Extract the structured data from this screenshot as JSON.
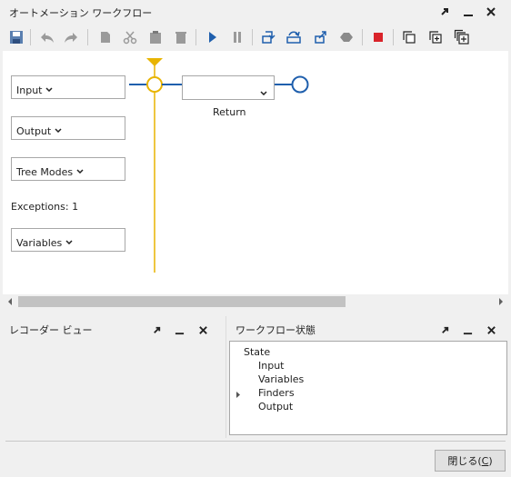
{
  "window": {
    "title": "オートメーション ワークフロー",
    "controls": [
      "float",
      "minimize",
      "close"
    ]
  },
  "toolbar": {
    "buttons": [
      "save-icon",
      "undo-icon",
      "redo-icon",
      "copy-icon",
      "cut-icon",
      "paste-icon",
      "delete-icon",
      "run-icon",
      "pause-icon",
      "step-into-icon",
      "step-over-icon",
      "step-out-icon",
      "breakpoint-icon",
      "stop-icon",
      "collapse-icon",
      "expand-icon",
      "expand-all-icon"
    ]
  },
  "canvas": {
    "input_label": "Input",
    "output_label": "Output",
    "tree_modes_label": "Tree Modes",
    "exceptions_label": "Exceptions: 1",
    "variables_label": "Variables",
    "return_label": "Return",
    "return_select_value": ""
  },
  "recorder_panel": {
    "title": "レコーダー ビュー"
  },
  "state_panel": {
    "title": "ワークフロー状態",
    "root": "State",
    "items": [
      "Input",
      "Variables",
      "Finders",
      "Output"
    ]
  },
  "footer": {
    "close_button_text": "閉じる(",
    "close_button_key": "C",
    "close_button_suffix": ")"
  },
  "colors": {
    "accent_blue": "#1f5fad",
    "accent_yellow": "#e8b400",
    "stop_red": "#d9232a"
  }
}
